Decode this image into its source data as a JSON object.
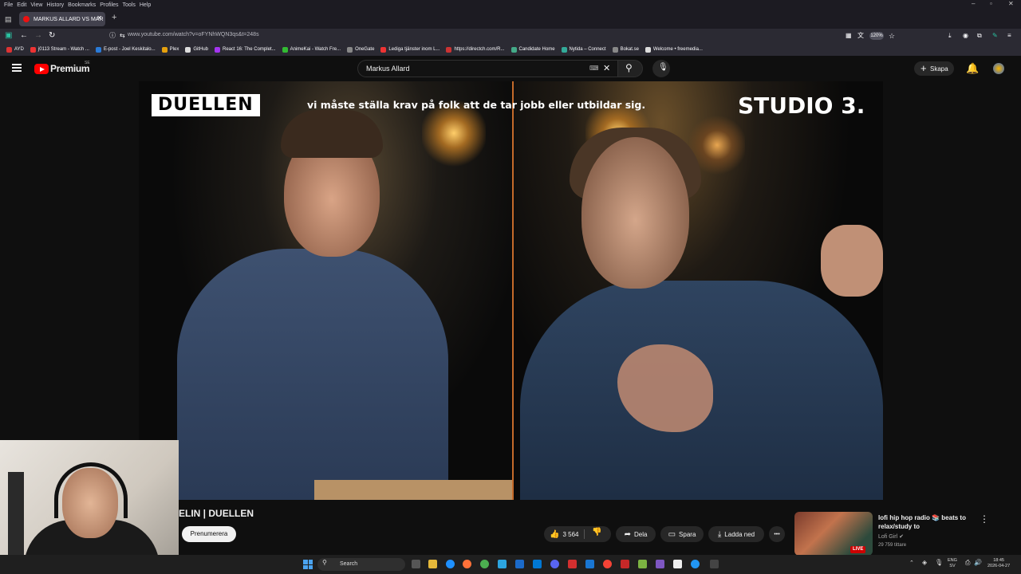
{
  "browser": {
    "menu": [
      "File",
      "Edit",
      "View",
      "History",
      "Bookmarks",
      "Profiles",
      "Tools",
      "Help"
    ],
    "tab_title": "MARKUS ALLARD VS MAR",
    "new_tab": "+",
    "url": "www.youtube.com/watch?v=oFYNhWQN3qs&t=248s",
    "zoom": "120%",
    "bookmarks": [
      {
        "label": "AYD",
        "color": "#d33"
      },
      {
        "label": "j0113 Stream - Watch ...",
        "color": "#e33"
      },
      {
        "label": "E-post - Joel Keskitalo...",
        "color": "#2a7bd8"
      },
      {
        "label": "Plex",
        "color": "#e5a00d"
      },
      {
        "label": "GitHub",
        "color": "#ddd"
      },
      {
        "label": "React 16: The Complet...",
        "color": "#a435f0"
      },
      {
        "label": "AnimeKai - Watch Fre...",
        "color": "#3b3"
      },
      {
        "label": "OneGate",
        "color": "#888"
      },
      {
        "label": "Lediga tjänster inom L...",
        "color": "#e33"
      },
      {
        "label": "https://directch.com/R...",
        "color": "#c33"
      },
      {
        "label": "Candidate Home",
        "color": "#4a8"
      },
      {
        "label": "Nytida – Connect",
        "color": "#3a9"
      },
      {
        "label": "Bokat.se",
        "color": "#888"
      },
      {
        "label": "Welcome • freemedia...",
        "color": "#ddd"
      }
    ]
  },
  "youtube": {
    "logo_text": "Premium",
    "region": "SE",
    "search_value": "Markus Allard",
    "create_label": "Skapa"
  },
  "video": {
    "overlay_title": "DUELLEN",
    "overlay_subtitle": "vi måste ställa krav på folk att de tar jobb eller utbildar sig.",
    "overlay_brand": "STUDIO 3."
  },
  "below": {
    "title_visible": "ELIN | DUELLEN",
    "subscribe_label": "Prenumerera",
    "likes": "3 564",
    "share_label": "Dela",
    "save_label": "Spara",
    "download_label": "Ladda ned",
    "more": "•••"
  },
  "recommendation": {
    "title": "lofi hip hop radio 📚 beats to relax/study to",
    "channel": "Lofi Girl",
    "viewers": "29 759 tittare",
    "live_badge": "LIVE"
  },
  "taskbar": {
    "search_label": "Search",
    "lang_top": "ENG",
    "lang_bottom": "SV",
    "time": "18:45",
    "date": "2026-04-27"
  }
}
